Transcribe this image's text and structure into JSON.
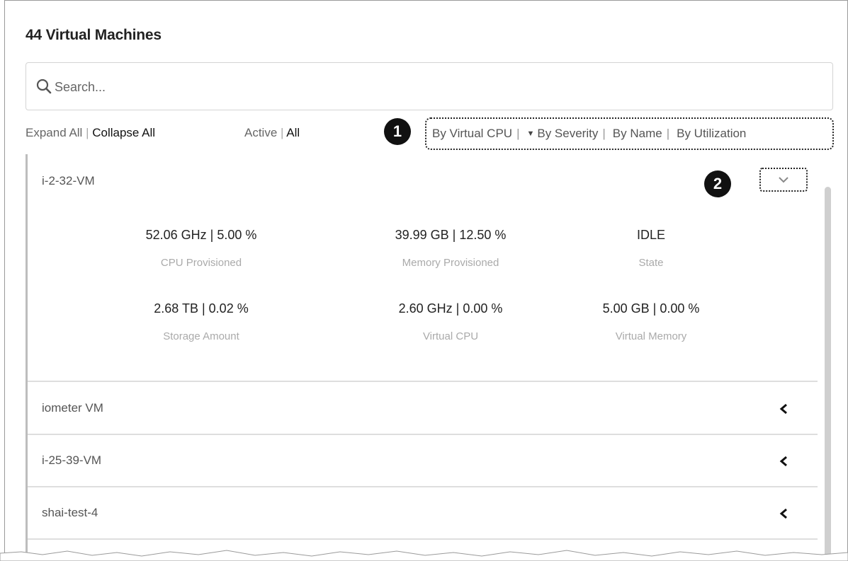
{
  "header": {
    "title": "44 Virtual Machines"
  },
  "search": {
    "placeholder": "Search...",
    "icon": "search-icon"
  },
  "controls": {
    "expand_all": "Expand All",
    "collapse_all": "Collapse All",
    "active": "Active",
    "all": "All",
    "separator": "|"
  },
  "sort_options": [
    {
      "label": "By Virtual CPU"
    },
    {
      "label": "By Severity",
      "selected": true,
      "icon": "caret-down-icon"
    },
    {
      "label": "By Name"
    },
    {
      "label": "By Utilization"
    }
  ],
  "callouts": {
    "one": "1",
    "two": "2"
  },
  "vms": {
    "expanded": {
      "name": "i-2-32-VM",
      "metrics": [
        {
          "value": "52.06 GHz   |   5.00 %",
          "label": "CPU Provisioned"
        },
        {
          "value": "39.99 GB   |   12.50 %",
          "label": "Memory Provisioned"
        },
        {
          "value": "IDLE",
          "label": "State"
        },
        {
          "value": "2.68 TB   |   0.02 %",
          "label": "Storage Amount"
        },
        {
          "value": "2.60 GHz   |   0.00 %",
          "label": "Virtual CPU"
        },
        {
          "value": "5.00 GB   |   0.00 %",
          "label": "Virtual Memory"
        }
      ]
    },
    "collapsed": [
      {
        "name": "iometer VM"
      },
      {
        "name": "i-25-39-VM"
      },
      {
        "name": "shai-test-4"
      }
    ]
  },
  "colors": {
    "badge": "#111111",
    "divider": "#dedede",
    "accent_border": "#bdbdbd"
  }
}
